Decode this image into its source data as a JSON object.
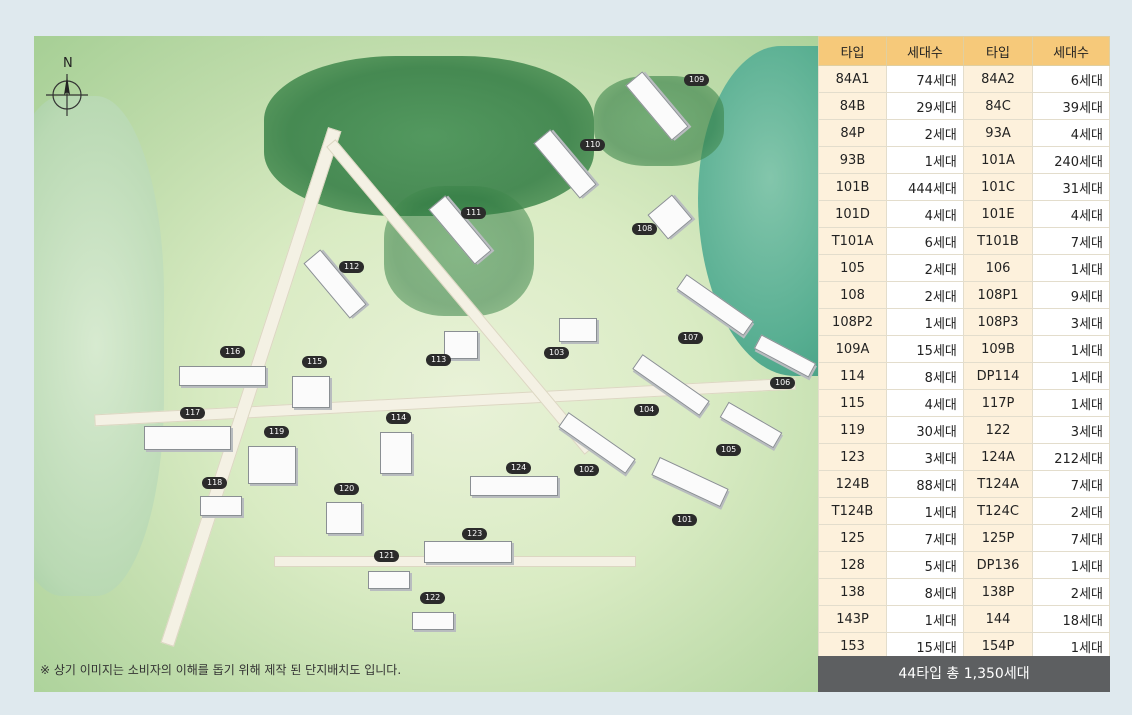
{
  "compass": {
    "label": "N"
  },
  "note": "※ 상기 이미지는 소비자의 이해를 돕기 위해 제작 된 단지배치도 입니다.",
  "buildings": [
    "109",
    "110",
    "111",
    "108",
    "112",
    "113",
    "103",
    "107",
    "116",
    "115",
    "106",
    "104",
    "117",
    "114",
    "119",
    "105",
    "102",
    "124",
    "118",
    "120",
    "101",
    "123",
    "121",
    "122"
  ],
  "table": {
    "headers": [
      "타입",
      "세대수",
      "타입",
      "세대수"
    ],
    "rows": [
      [
        "84A1",
        "74세대",
        "84A2",
        "6세대"
      ],
      [
        "84B",
        "29세대",
        "84C",
        "39세대"
      ],
      [
        "84P",
        "2세대",
        "93A",
        "4세대"
      ],
      [
        "93B",
        "1세대",
        "101A",
        "240세대"
      ],
      [
        "101B",
        "444세대",
        "101C",
        "31세대"
      ],
      [
        "101D",
        "4세대",
        "101E",
        "4세대"
      ],
      [
        "T101A",
        "6세대",
        "T101B",
        "7세대"
      ],
      [
        "105",
        "2세대",
        "106",
        "1세대"
      ],
      [
        "108",
        "2세대",
        "108P1",
        "9세대"
      ],
      [
        "108P2",
        "1세대",
        "108P3",
        "3세대"
      ],
      [
        "109A",
        "15세대",
        "109B",
        "1세대"
      ],
      [
        "114",
        "8세대",
        "DP114",
        "1세대"
      ],
      [
        "115",
        "4세대",
        "117P",
        "1세대"
      ],
      [
        "119",
        "30세대",
        "122",
        "3세대"
      ],
      [
        "123",
        "3세대",
        "124A",
        "212세대"
      ],
      [
        "124B",
        "88세대",
        "T124A",
        "7세대"
      ],
      [
        "T124B",
        "1세대",
        "T124C",
        "2세대"
      ],
      [
        "125",
        "7세대",
        "125P",
        "7세대"
      ],
      [
        "128",
        "5세대",
        "DP136",
        "1세대"
      ],
      [
        "138",
        "8세대",
        "138P",
        "2세대"
      ],
      [
        "143P",
        "1세대",
        "144",
        "18세대"
      ],
      [
        "153",
        "15세대",
        "154P",
        "1세대"
      ]
    ],
    "total": "44타입 총 1,350세대"
  }
}
